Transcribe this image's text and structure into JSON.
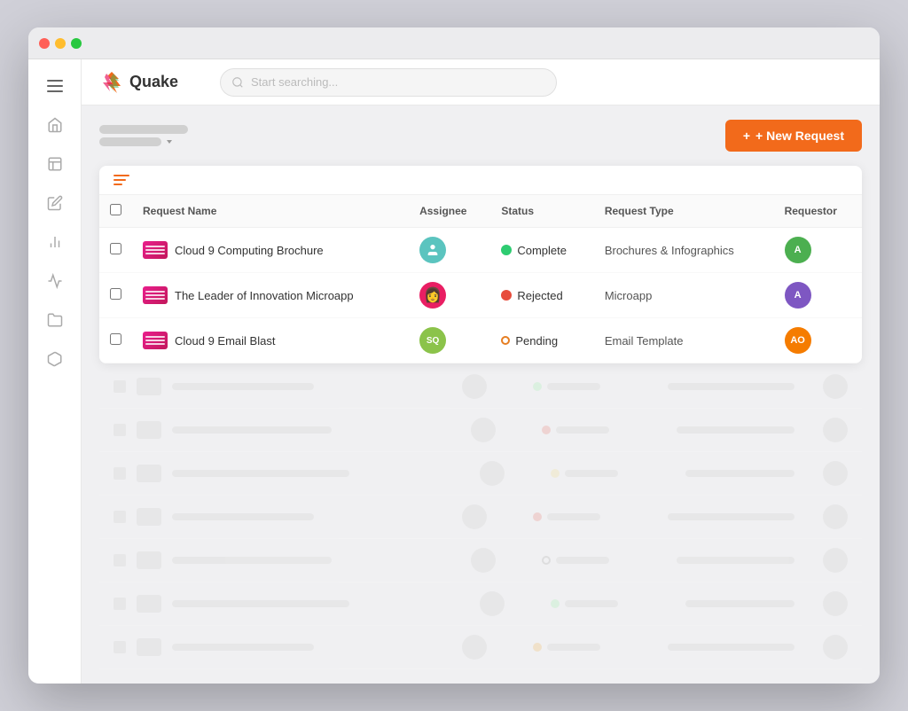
{
  "window": {
    "title": "Quake"
  },
  "logo": {
    "text": "Quake"
  },
  "search": {
    "placeholder": "Start searching..."
  },
  "header": {
    "new_request_label": "+ New Request",
    "breadcrumb_line1": "",
    "breadcrumb_line2": ""
  },
  "table": {
    "columns": {
      "request_name": "Request Name",
      "assignee": "Assignee",
      "status": "Status",
      "request_type": "Request Type",
      "requestor": "Requestor"
    },
    "rows": [
      {
        "id": 1,
        "name": "Cloud 9 Computing Brochure",
        "assignee_color": "#5bc4bf",
        "assignee_initials": "",
        "assignee_type": "icon",
        "status": "Complete",
        "status_type": "complete",
        "request_type": "Brochures & Infographics",
        "requestor_color": "#4caf50",
        "requestor_initials": "A"
      },
      {
        "id": 2,
        "name": "The Leader of Innovation Microapp",
        "assignee_color": "#e91e63",
        "assignee_initials": "",
        "assignee_type": "photo",
        "status": "Rejected",
        "status_type": "rejected",
        "request_type": "Microapp",
        "requestor_color": "#7e57c2",
        "requestor_initials": "A"
      },
      {
        "id": 3,
        "name": "Cloud 9 Email Blast",
        "assignee_color": "#8bc34a",
        "assignee_initials": "SQ",
        "assignee_type": "initials",
        "status": "Pending",
        "status_type": "pending",
        "request_type": "Email Template",
        "requestor_color": "#f57c00",
        "requestor_initials": "AO"
      }
    ]
  },
  "sidebar": {
    "icons": [
      "☰",
      "🏠",
      "📋",
      "✏️",
      "📊",
      "📈",
      "📁",
      "📦"
    ]
  },
  "blurred_rows": [
    {
      "dot_color": "green"
    },
    {
      "dot_color": "red-solid"
    },
    {
      "dot_color": "yellow"
    },
    {
      "dot_color": "red-solid"
    },
    {
      "dot_color": "outline"
    },
    {
      "dot_color": "green"
    },
    {
      "dot_color": "yellow-solid"
    }
  ]
}
